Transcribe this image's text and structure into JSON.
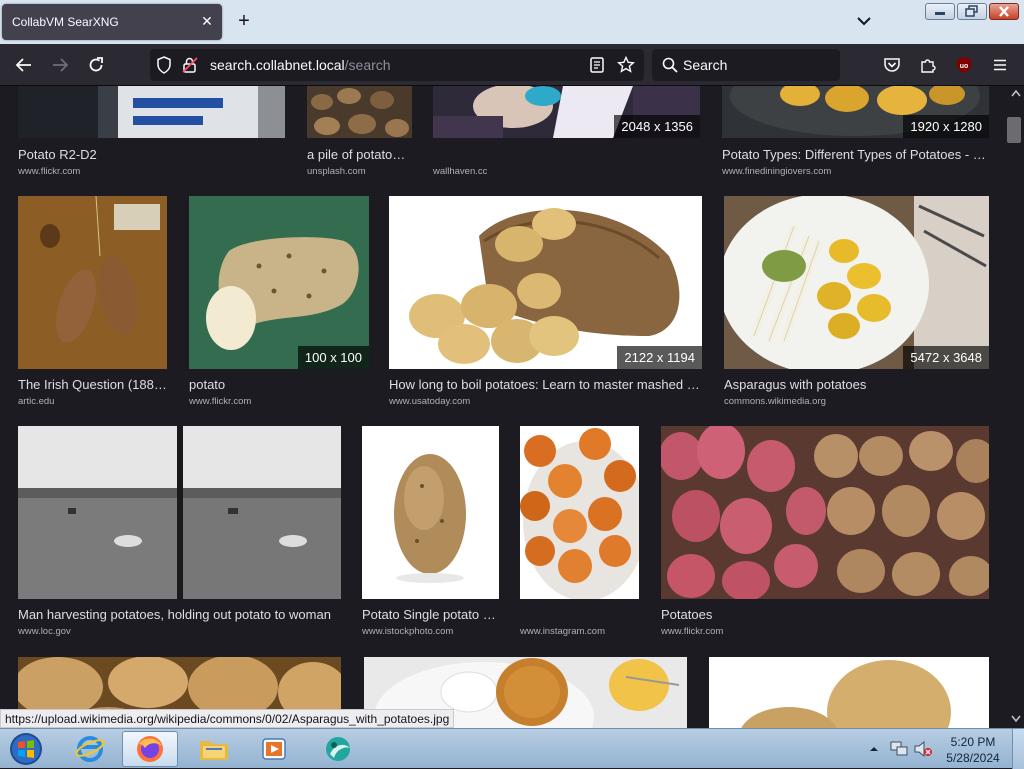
{
  "browser": {
    "tab_title": "CollabVM SearXNG",
    "url_host": "search.collabnet.local",
    "url_path": "/search",
    "search_placeholder": "Search"
  },
  "results": [
    {
      "title": "Potato R2-D2",
      "site": "www.flickr.com",
      "resolution": ""
    },
    {
      "title": "a pile of potatoe…",
      "site": "unsplash.com",
      "resolution": ""
    },
    {
      "title": "",
      "site": "wallhaven.cc",
      "resolution": "2048 x 1356"
    },
    {
      "title": "Potato Types: Different Types of Potatoes - …",
      "site": "www.finediningiovers.com",
      "resolution": "1920 x 1280"
    },
    {
      "title": "The Irish Question (188…",
      "site": "artic.edu",
      "resolution": ""
    },
    {
      "title": "potato",
      "site": "www.flickr.com",
      "resolution": "100 x 100"
    },
    {
      "title": "How long to boil potatoes: Learn to master mashed …",
      "site": "www.usatoday.com",
      "resolution": "2122 x 1194"
    },
    {
      "title": "Asparagus with potatoes",
      "site": "commons.wikimedia.org",
      "resolution": "5472 x 3648"
    },
    {
      "title": "Man harvesting potatoes, holding out potato to woman",
      "site": "www.loc.gov",
      "resolution": ""
    },
    {
      "title": "Potato Single potato …",
      "site": "www.istockphoto.com",
      "resolution": ""
    },
    {
      "title": "",
      "site": "www.instagram.com",
      "resolution": ""
    },
    {
      "title": "Potatoes",
      "site": "www.flickr.com",
      "resolution": ""
    }
  ],
  "status_url": "https://upload.wikimedia.org/wikipedia/commons/0/02/Asparagus_with_potatoes.jpg",
  "taskbar": {
    "time": "5:20 PM",
    "date": "5/28/2024"
  }
}
